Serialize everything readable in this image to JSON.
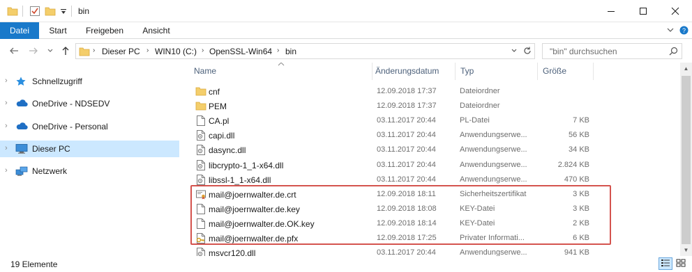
{
  "window": {
    "title": "bin",
    "icons": [
      "folder-icon",
      "properties-checkbox-icon",
      "new-folder-icon",
      "qat-dropdown-icon"
    ],
    "controls": {
      "minimize": "–",
      "maximize": "☐",
      "close": "✕"
    }
  },
  "ribbon": {
    "tabs": [
      {
        "label": "Datei",
        "active": true
      },
      {
        "label": "Start"
      },
      {
        "label": "Freigeben"
      },
      {
        "label": "Ansicht"
      }
    ],
    "accent_color": "#1979ca"
  },
  "address": {
    "breadcrumbs": [
      "Dieser PC",
      "WIN10 (C:)",
      "OpenSSL-Win64",
      "bin"
    ],
    "search_placeholder": "\"bin\" durchsuchen"
  },
  "nav": {
    "items": [
      {
        "label": "Schnellzugriff",
        "icon": "star-icon"
      },
      {
        "label": "OneDrive - NDSEDV",
        "icon": "cloud-icon"
      },
      {
        "label": "OneDrive - Personal",
        "icon": "cloud-icon"
      },
      {
        "label": "Dieser PC",
        "icon": "computer-icon",
        "selected": true
      },
      {
        "label": "Netzwerk",
        "icon": "network-icon"
      }
    ]
  },
  "columns": {
    "name": "Name",
    "date": "Änderungsdatum",
    "type": "Typ",
    "size": "Größe"
  },
  "files": [
    {
      "name": "cnf",
      "date": "12.09.2018 17:37",
      "type": "Dateiordner",
      "size": "",
      "icon": "folder-icon"
    },
    {
      "name": "PEM",
      "date": "12.09.2018 17:37",
      "type": "Dateiordner",
      "size": "",
      "icon": "folder-icon"
    },
    {
      "name": "CA.pl",
      "date": "03.11.2017 20:44",
      "type": "PL-Datei",
      "size": "7 KB",
      "icon": "file-icon"
    },
    {
      "name": "capi.dll",
      "date": "03.11.2017 20:44",
      "type": "Anwendungserwe...",
      "size": "56 KB",
      "icon": "dll-icon"
    },
    {
      "name": "dasync.dll",
      "date": "03.11.2017 20:44",
      "type": "Anwendungserwe...",
      "size": "34 KB",
      "icon": "dll-icon"
    },
    {
      "name": "libcrypto-1_1-x64.dll",
      "date": "03.11.2017 20:44",
      "type": "Anwendungserwe...",
      "size": "2.824 KB",
      "icon": "dll-icon"
    },
    {
      "name": "libssl-1_1-x64.dll",
      "date": "03.11.2017 20:44",
      "type": "Anwendungserwe...",
      "size": "470 KB",
      "icon": "dll-icon"
    },
    {
      "name": "mail@joernwalter.de.crt",
      "date": "12.09.2018 18:11",
      "type": "Sicherheitszertifikat",
      "size": "3 KB",
      "icon": "certificate-icon"
    },
    {
      "name": "mail@joernwalter.de.key",
      "date": "12.09.2018 18:08",
      "type": "KEY-Datei",
      "size": "3 KB",
      "icon": "file-icon"
    },
    {
      "name": "mail@joernwalter.de.OK.key",
      "date": "12.09.2018 18:14",
      "type": "KEY-Datei",
      "size": "2 KB",
      "icon": "file-icon"
    },
    {
      "name": "mail@joernwalter.de.pfx",
      "date": "12.09.2018 17:25",
      "type": "Privater Informati...",
      "size": "6 KB",
      "icon": "pfx-icon"
    },
    {
      "name": "msvcr120.dll",
      "date": "03.11.2017 20:44",
      "type": "Anwendungserwe...",
      "size": "941 KB",
      "icon": "dll-icon"
    }
  ],
  "highlight_color": "#d4534e",
  "status": {
    "count": "19 Elemente",
    "views": [
      "details-view-icon",
      "large-icons-view-icon"
    ]
  }
}
